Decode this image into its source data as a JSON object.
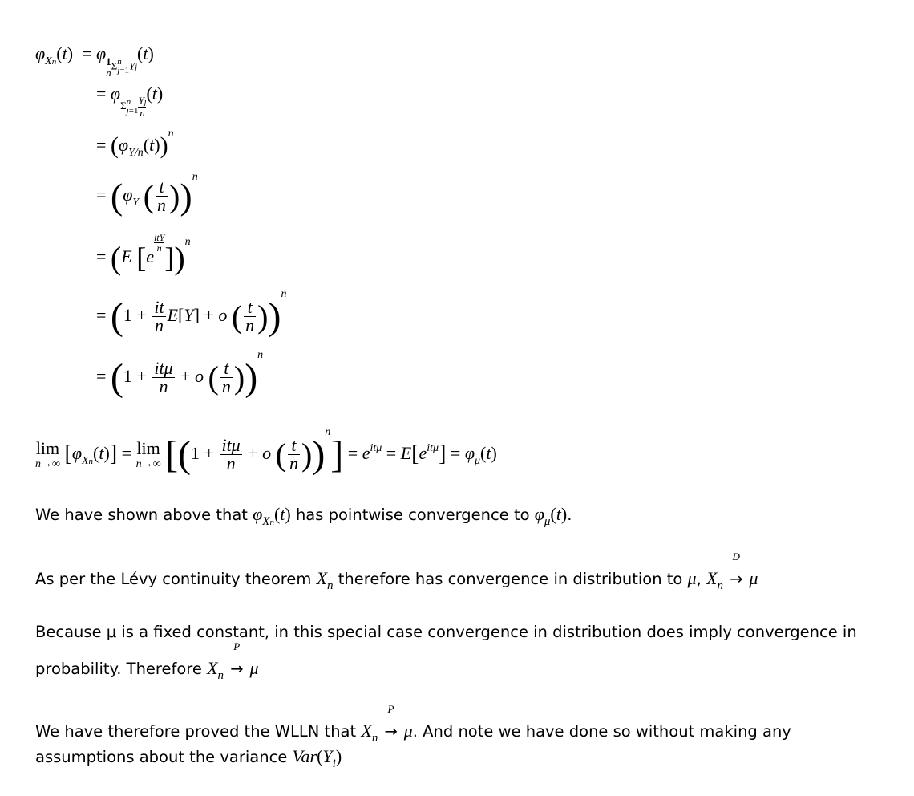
{
  "derivation": {
    "lhs": "φXn(t)",
    "steps": [
      "= φ(1/n)Σj=1..n Yj(t)",
      "= φΣj=1..n Yj/n(t)",
      "= (φY/n(t))^n",
      "= (φY(t/n))^n",
      "= (E[e^(itY/n)])^n",
      "= (1 + (it/n)E[Y] + o(t/n))^n",
      "= (1 + itμ/n + o(t/n))^n"
    ]
  },
  "limit_line": "lim n→∞ [φXn(t)] = lim n→∞ [(1 + itμ/n + o(t/n))^n] = e^(itμ) = E[e^(itμ)] = φμ(t)",
  "paragraphs": {
    "p1_a": "We have shown above that ",
    "p1_b": " has pointwise convergence to ",
    "p1_c": ".",
    "p2_a": "As per the Lévy continuity theorem ",
    "p2_b": " therefore has convergence in distribution to ",
    "p2_c": ", ",
    "p3_line1": "Because μ is a fixed constant, in this special case convergence in distribution does imply convergence in",
    "p3_line2_a": "probability. Therefore ",
    "p4_a": "We have therefore proved the WLLN that ",
    "p4_b": ". And note we have done so without making any",
    "p4_line2": "assumptions about the variance "
  },
  "arrow_labels": {
    "distribution": "D",
    "probability": "P"
  }
}
